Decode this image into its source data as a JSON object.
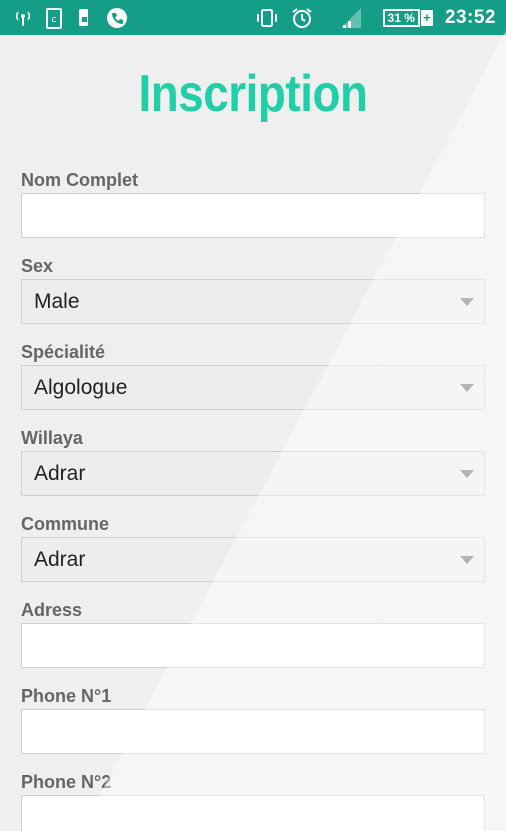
{
  "status_bar": {
    "time": "23:52",
    "battery_percent": "31 %",
    "battery_plus": "+",
    "icons": [
      "antenna-icon",
      "clipboard-icon",
      "phone-lock-icon",
      "phone-call-icon",
      "vibrate-icon",
      "alarm-icon",
      "signal-icon",
      "battery-icon"
    ],
    "bar_color": "#149e88"
  },
  "page": {
    "title": "Inscription",
    "title_color": "#1ecfa8"
  },
  "form": {
    "nom_complet": {
      "label": "Nom Complet",
      "value": ""
    },
    "sex": {
      "label": "Sex",
      "value": "Male"
    },
    "specialite": {
      "label": "Spécialité",
      "value": "Algologue"
    },
    "willaya": {
      "label": "Willaya",
      "value": "Adrar"
    },
    "commune": {
      "label": "Commune",
      "value": "Adrar"
    },
    "adress": {
      "label": "Adress",
      "value": ""
    },
    "phone1": {
      "label": "Phone N°1",
      "value": ""
    },
    "phone2": {
      "label": "Phone N°2",
      "value": ""
    }
  }
}
